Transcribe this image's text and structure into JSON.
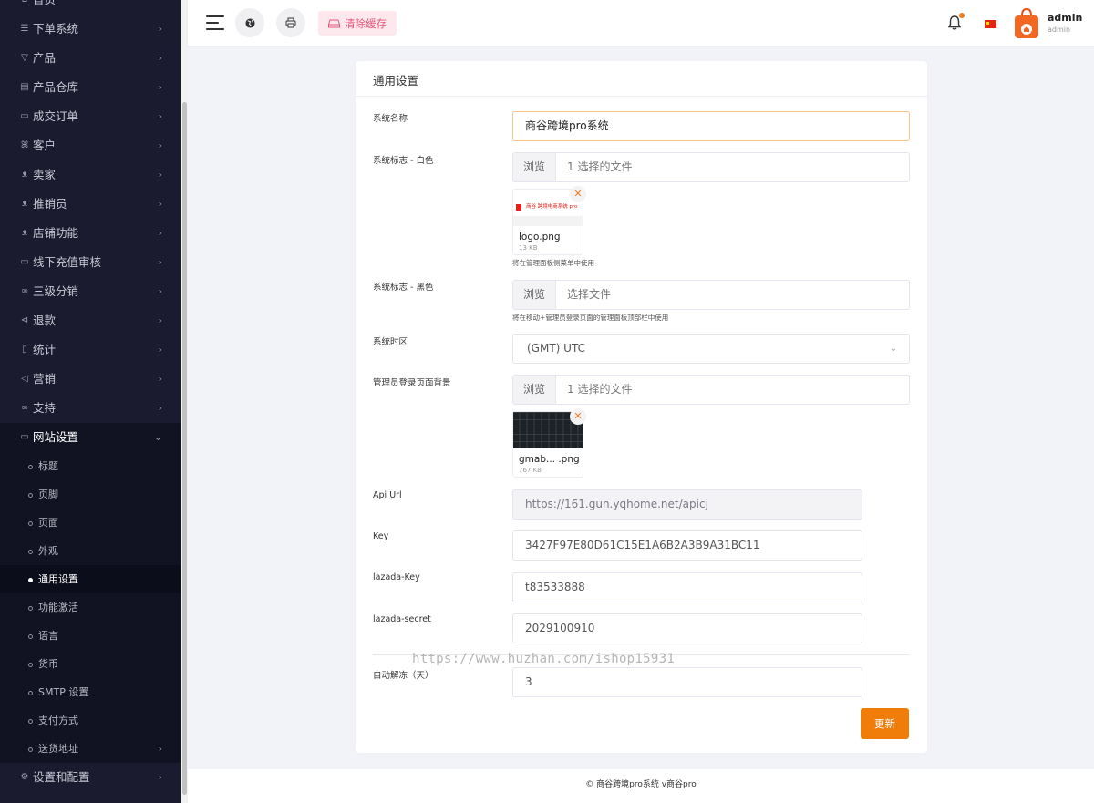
{
  "sidebar": {
    "items": [
      {
        "label": "首页",
        "icon": "home-icon",
        "glyph": "⌂",
        "has_children": false
      },
      {
        "label": "下单系统",
        "icon": "list-icon",
        "glyph": "☰",
        "has_children": true
      },
      {
        "label": "产品",
        "icon": "cart-icon",
        "glyph": "▽",
        "has_children": true
      },
      {
        "label": "产品仓库",
        "icon": "warehouse-icon",
        "glyph": "▤",
        "has_children": true
      },
      {
        "label": "成交订单",
        "icon": "order-icon",
        "glyph": "▭",
        "has_children": true
      },
      {
        "label": "客户",
        "icon": "users-icon",
        "glyph": "ꕤ",
        "has_children": true
      },
      {
        "label": "卖家",
        "icon": "user-icon",
        "glyph": "ᴥ",
        "has_children": true
      },
      {
        "label": "推销员",
        "icon": "user-icon",
        "glyph": "ᴥ",
        "has_children": true
      },
      {
        "label": "店铺功能",
        "icon": "user-icon",
        "glyph": "ᴥ",
        "has_children": true
      },
      {
        "label": "线下充值审核",
        "icon": "money-icon",
        "glyph": "▭",
        "has_children": true
      },
      {
        "label": "三级分销",
        "icon": "link-icon",
        "glyph": "∞",
        "has_children": true
      },
      {
        "label": "退款",
        "icon": "refund-icon",
        "glyph": "⊲",
        "has_children": true
      },
      {
        "label": "统计",
        "icon": "report-icon",
        "glyph": "▯",
        "has_children": true
      },
      {
        "label": "营销",
        "icon": "megaphone-icon",
        "glyph": "◁",
        "has_children": true
      },
      {
        "label": "支持",
        "icon": "support-icon",
        "glyph": "∞",
        "has_children": true
      }
    ],
    "open_section": {
      "label": "网站设置",
      "icon": "monitor-icon",
      "children": [
        {
          "label": "标题",
          "active": false,
          "has_children": false
        },
        {
          "label": "页脚",
          "active": false,
          "has_children": false
        },
        {
          "label": "页面",
          "active": false,
          "has_children": false
        },
        {
          "label": "外观",
          "active": false,
          "has_children": false
        },
        {
          "label": "通用设置",
          "active": true,
          "has_children": false
        },
        {
          "label": "功能激活",
          "active": false,
          "has_children": false
        },
        {
          "label": "语言",
          "active": false,
          "has_children": false
        },
        {
          "label": "货币",
          "active": false,
          "has_children": false
        },
        {
          "label": "SMTP 设置",
          "active": false,
          "has_children": false
        },
        {
          "label": "支付方式",
          "active": false,
          "has_children": false
        },
        {
          "label": "送货地址",
          "active": false,
          "has_children": true
        }
      ]
    },
    "last_item": {
      "label": "设置和配置",
      "icon": "gear-icon"
    }
  },
  "header": {
    "clear_cache_label": "清除缓存",
    "user_name": "admin",
    "user_role": "admin",
    "accent_color": "#f07c0a"
  },
  "form": {
    "title": "通用设置",
    "system_name": {
      "label": "系统名称",
      "value": "商谷跨境pro系统"
    },
    "logo_white": {
      "label": "系统标志 - 白色",
      "browse": "浏览",
      "file_text": "1 选择的文件",
      "file_name": "logo.png",
      "file_size": "13 KB",
      "preview_text": "商谷 跨境电商系统 pro",
      "help": "将在管理面板侧菜单中使用"
    },
    "logo_black": {
      "label": "系统标志 - 黑色",
      "browse": "浏览",
      "file_text": "选择文件",
      "help": "将在移动+管理员登录页面的管理面板顶部栏中使用"
    },
    "timezone": {
      "label": "系统时区",
      "value": "(GMT) UTC"
    },
    "login_bg": {
      "label": "管理员登录页面背景",
      "browse": "浏览",
      "file_text": "1 选择的文件",
      "file_name": "gmab... .png",
      "file_size": "767 KB"
    },
    "api_url": {
      "label": "Api Url",
      "value": "https://161.gun.yqhome.net/apicj"
    },
    "key": {
      "label": "Key",
      "value": "3427F97E80D61C15E1A6B2A3B9A31BC11"
    },
    "lazada_key": {
      "label": "lazada-Key",
      "value": "t83533888"
    },
    "lazada_secret": {
      "label": "lazada-secret",
      "value": "2029100910"
    },
    "auto_thaw": {
      "label": "自动解冻（天）",
      "value": "3"
    },
    "update_label": "更新"
  },
  "watermark": "https://www.huzhan.com/ishop15931",
  "footer": "© 商谷跨境pro系统 v商谷pro"
}
